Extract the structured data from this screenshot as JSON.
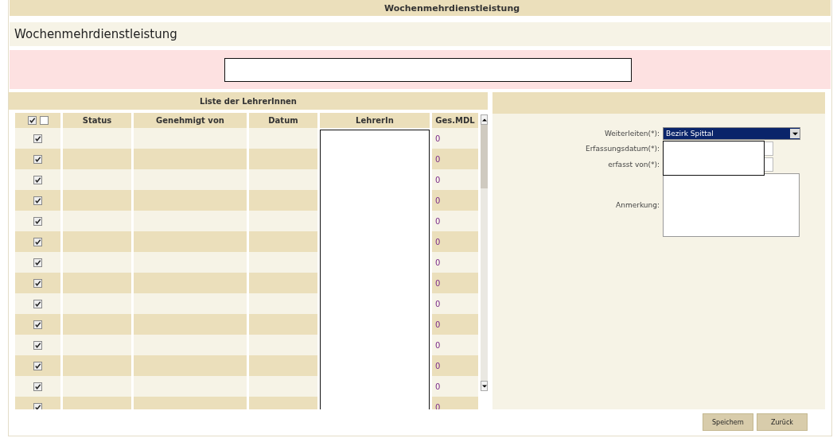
{
  "banner": {
    "title": "Wochenmehrdienstleistung"
  },
  "page_title": "Wochenmehrdienstleistung",
  "list": {
    "title": "Liste der LehrerInnen",
    "header_checks": [
      {
        "checked": true
      },
      {
        "checked": false
      }
    ],
    "columns": [
      "Status",
      "Genehmigt von",
      "Datum",
      "LehrerIn",
      "Ges.MDL"
    ],
    "rows": [
      {
        "checked": true,
        "ges_mdl": "0"
      },
      {
        "checked": true,
        "ges_mdl": "0"
      },
      {
        "checked": true,
        "ges_mdl": "0"
      },
      {
        "checked": true,
        "ges_mdl": "0"
      },
      {
        "checked": true,
        "ges_mdl": "0"
      },
      {
        "checked": true,
        "ges_mdl": "0"
      },
      {
        "checked": true,
        "ges_mdl": "0"
      },
      {
        "checked": true,
        "ges_mdl": "0"
      },
      {
        "checked": true,
        "ges_mdl": "0"
      },
      {
        "checked": true,
        "ges_mdl": "0"
      },
      {
        "checked": true,
        "ges_mdl": "0"
      },
      {
        "checked": true,
        "ges_mdl": "0"
      },
      {
        "checked": true,
        "ges_mdl": "0"
      },
      {
        "checked": true,
        "ges_mdl": "0"
      }
    ]
  },
  "form": {
    "fields": [
      {
        "kind": "select",
        "label": "Weiterleiten(*):",
        "value": "Bezirk Spittal"
      },
      {
        "kind": "text",
        "label": "Erfassungsdatum(*):"
      },
      {
        "kind": "text",
        "label": "erfasst von(*):"
      },
      {
        "kind": "textarea",
        "label": "Anmerkung:"
      }
    ]
  },
  "buttons": [
    "Speichern",
    "Zurück"
  ]
}
